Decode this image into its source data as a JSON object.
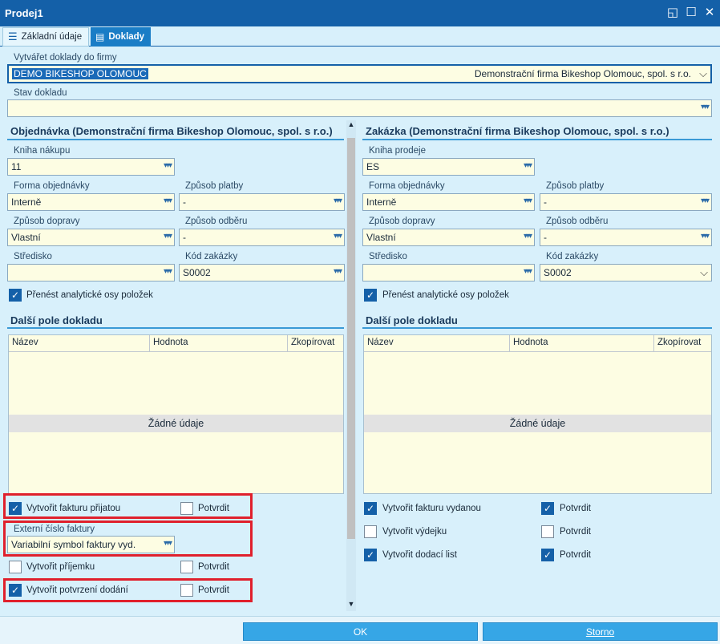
{
  "window": {
    "title": "Prodej1"
  },
  "tabs": [
    {
      "label": "Základní údaje"
    },
    {
      "label": "Doklady"
    }
  ],
  "company": {
    "label": "Vytvářet doklady do firmy",
    "value": "DEMO BIKESHOP OLOMOUC",
    "desc": "Demonstrační firma Bikeshop Olomouc, spol. s r.o."
  },
  "status": {
    "label": "Stav dokladu",
    "value": ""
  },
  "left": {
    "title": "Objednávka (Demonstrační firma Bikeshop Olomouc, spol. s r.o.)",
    "book_label": "Kniha nákupu",
    "book": "11",
    "form_label": "Forma objednávky",
    "form": "Interně",
    "pay_label": "Způsob platby",
    "pay": "-",
    "ship_label": "Způsob dopravy",
    "ship": "Vlastní",
    "pick_label": "Způsob odběru",
    "pick": "-",
    "center_label": "Středisko",
    "center": "",
    "code_label": "Kód zakázky",
    "code": "S0002",
    "axes_label": "Přenést analytické osy položek",
    "more_title": "Další pole dokladu",
    "cols": [
      "Název",
      "Hodnota",
      "Zkopírovat"
    ],
    "nodata": "Žádné údaje",
    "inv_label": "Vytvořit fakturu přijatou",
    "confirm": "Potvrdit",
    "ext_label": "Externí číslo faktury",
    "ext": "Variabilní symbol faktury vyd.",
    "rcpt_label": "Vytvořit příjemku",
    "deliv_label": "Vytvořit potvrzení dodání"
  },
  "right": {
    "title": "Zakázka (Demonstrační firma Bikeshop Olomouc, spol. s r.o.)",
    "book_label": "Kniha prodeje",
    "book": "ES",
    "form_label": "Forma objednávky",
    "form": "Interně",
    "pay_label": "Způsob platby",
    "pay": "-",
    "ship_label": "Způsob dopravy",
    "ship": "Vlastní",
    "pick_label": "Způsob odběru",
    "pick": "-",
    "center_label": "Středisko",
    "center": "",
    "code_label": "Kód zakázky",
    "code": "S0002",
    "axes_label": "Přenést analytické osy položek",
    "more_title": "Další pole dokladu",
    "cols": [
      "Název",
      "Hodnota",
      "Zkopírovat"
    ],
    "nodata": "Žádné údaje",
    "inv_label": "Vytvořit fakturu vydanou",
    "issue_label": "Vytvořit výdejku",
    "dn_label": "Vytvořit dodací list",
    "confirm": "Potvrdit"
  },
  "buttons": {
    "ok": "OK",
    "cancel": "Storno"
  },
  "icons": {
    "list": "list-icon",
    "docs": "documents-icon",
    "restore": "restore-icon",
    "maximize": "maximize-icon",
    "close": "close-icon"
  }
}
